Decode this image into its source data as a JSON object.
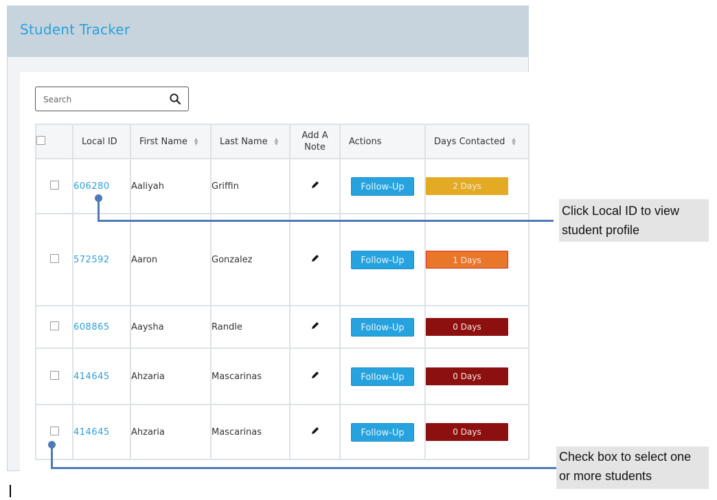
{
  "app": {
    "title": "Student Tracker"
  },
  "search": {
    "placeholder": "Search",
    "icon": "search-icon"
  },
  "table": {
    "columns": {
      "local_id": "Local ID",
      "first_name": "First Name",
      "last_name": "Last Name",
      "add_note": "Add A Note",
      "actions": "Actions",
      "days_contacted": "Days Contacted"
    },
    "rows": [
      {
        "local_id": "606280",
        "first_name": "Aaliyah",
        "last_name": "Griffin",
        "action": "Follow-Up",
        "days": "2 Days",
        "days_color": "#e3ab24"
      },
      {
        "local_id": "572592",
        "first_name": "Aaron",
        "last_name": "Gonzalez",
        "action": "Follow-Up",
        "days": "1 Days",
        "days_color": "#e9772a"
      },
      {
        "local_id": "608865",
        "first_name": "Aaysha",
        "last_name": "Randle",
        "action": "Follow-Up",
        "days": "0 Days",
        "days_color": "#8c1010"
      },
      {
        "local_id": "414645",
        "first_name": "Ahzaria",
        "last_name": "Mascarinas",
        "action": "Follow-Up",
        "days": "0 Days",
        "days_color": "#8c1010"
      },
      {
        "local_id": "414645",
        "first_name": "Ahzaria",
        "last_name": "Mascarinas",
        "action": "Follow-Up",
        "days": "0 Days",
        "days_color": "#8c1010"
      }
    ]
  },
  "callouts": {
    "local_id": {
      "line1": "Click Local ID to view",
      "line2": "student profile"
    },
    "checkbox": {
      "line1": "Check box to select one",
      "line2": "or more students"
    }
  },
  "colors": {
    "accent": "#2ba0d9",
    "header_bg": "#c7d4de",
    "connector": "#4f79b6"
  }
}
